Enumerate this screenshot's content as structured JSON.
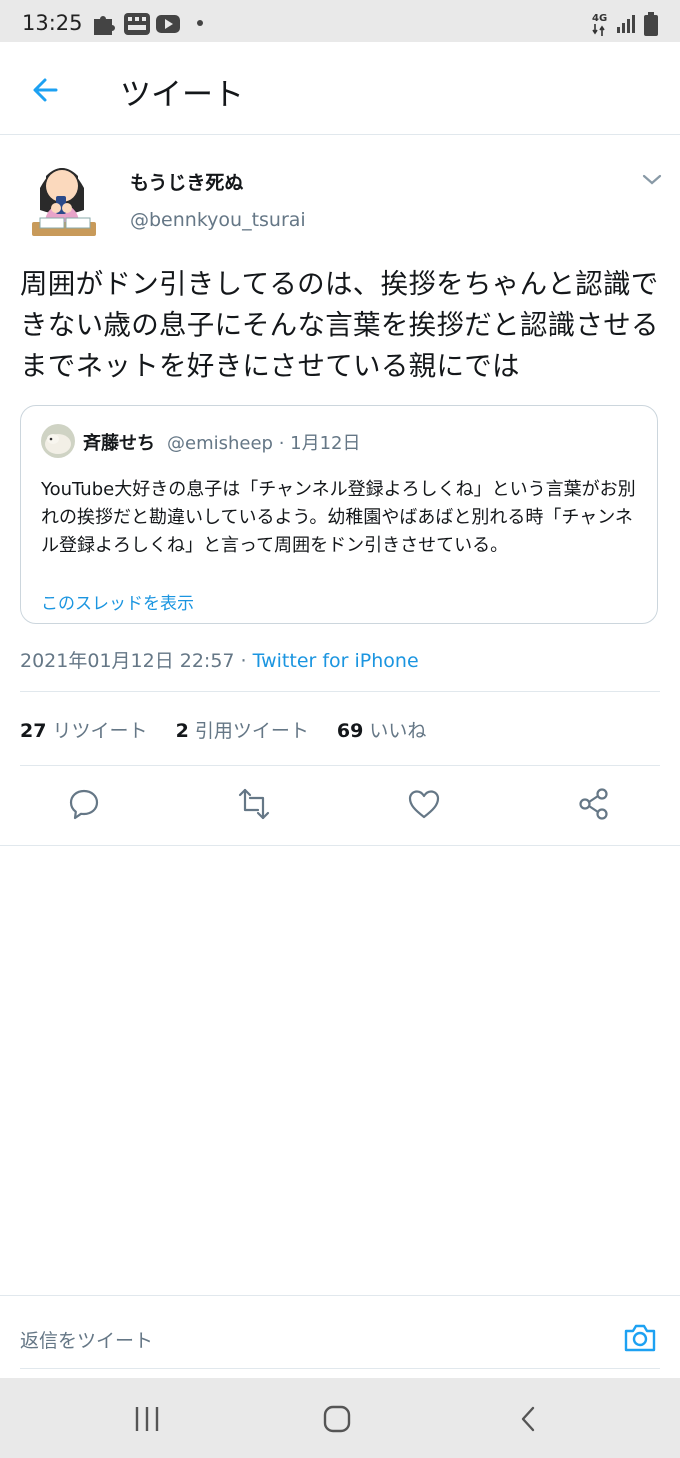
{
  "status_bar": {
    "time": "13:25",
    "network": "4G"
  },
  "header": {
    "title": "ツイート"
  },
  "tweet": {
    "author_name": "もうじき死ぬ",
    "author_handle": "@bennkyou_tsurai",
    "text": "周囲がドン引きしてるのは、挨拶をちゃんと認識できない歳の息子にそんな言葉を挨拶だと認識させるまでネットを好きにさせている親にでは",
    "timestamp": "2021年01月12日 22:57",
    "separator": " · ",
    "source": "Twitter for iPhone"
  },
  "quoted_tweet": {
    "author_name": "斉藤せち",
    "author_handle": "@emisheep",
    "date": "1月12日",
    "text": "YouTube大好きの息子は「チャンネル登録よろしくね」という言葉がお別れの挨拶だと勘違いしているよう。幼稚園やばあばと別れる時「チャンネル登録よろしくね」と言って周囲をドン引きさせている。",
    "thread_link": "このスレッドを表示"
  },
  "stats": {
    "retweets_count": "27",
    "retweets_label": "リツイート",
    "quotes_count": "2",
    "quotes_label": "引用ツイート",
    "likes_count": "69",
    "likes_label": "いいね"
  },
  "reply_box": {
    "placeholder": "返信をツイート"
  },
  "colors": {
    "accent": "#1da1f2",
    "secondary_text": "#657786",
    "divider": "#e1e8ed"
  },
  "icons": [
    "arrow-left-icon",
    "chevron-down-icon",
    "reply-icon",
    "retweet-icon",
    "heart-icon",
    "share-icon",
    "camera-icon"
  ]
}
